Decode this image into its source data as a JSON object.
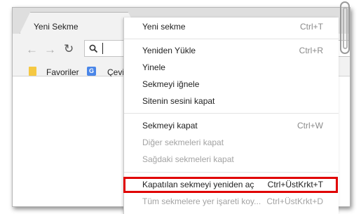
{
  "tab": {
    "title": "Yeni Sekme"
  },
  "toolbar": {
    "back_icon": "back-arrow-icon",
    "forward_icon": "forward-arrow-icon",
    "reload_icon": "reload-icon",
    "search_icon": "search-icon"
  },
  "bookmarks": [
    {
      "label": "Favoriler",
      "icon": "folder-icon"
    },
    {
      "label": "Çevir",
      "icon": "google-translate-icon"
    }
  ],
  "context_menu": {
    "items": [
      {
        "label": "Yeni sekme",
        "shortcut": "Ctrl+T",
        "enabled": true
      },
      {
        "label": "Yeniden Yükle",
        "shortcut": "Ctrl+R",
        "enabled": true
      },
      {
        "label": "Yinele",
        "shortcut": "",
        "enabled": true
      },
      {
        "label": "Sekmeyi iğnele",
        "shortcut": "",
        "enabled": true
      },
      {
        "label": "Sitenin sesini kapat",
        "shortcut": "",
        "enabled": true
      },
      {
        "label": "Sekmeyi kapat",
        "shortcut": "Ctrl+W",
        "enabled": true
      },
      {
        "label": "Diğer sekmeleri kapat",
        "shortcut": "",
        "enabled": false
      },
      {
        "label": "Sağdaki sekmeleri kapat",
        "shortcut": "",
        "enabled": false
      },
      {
        "label": "Kapatılan sekmeyi yeniden aç",
        "shortcut": "Ctrl+ÜstKrkt+T",
        "enabled": true,
        "highlighted": true
      },
      {
        "label": "Tüm sekmelere yer işareti koy...",
        "shortcut": "Ctrl+ÜstKrkt+D",
        "enabled": false
      }
    ]
  },
  "colors": {
    "highlight_border": "#e00000",
    "disabled_text": "#a3a3a3"
  }
}
